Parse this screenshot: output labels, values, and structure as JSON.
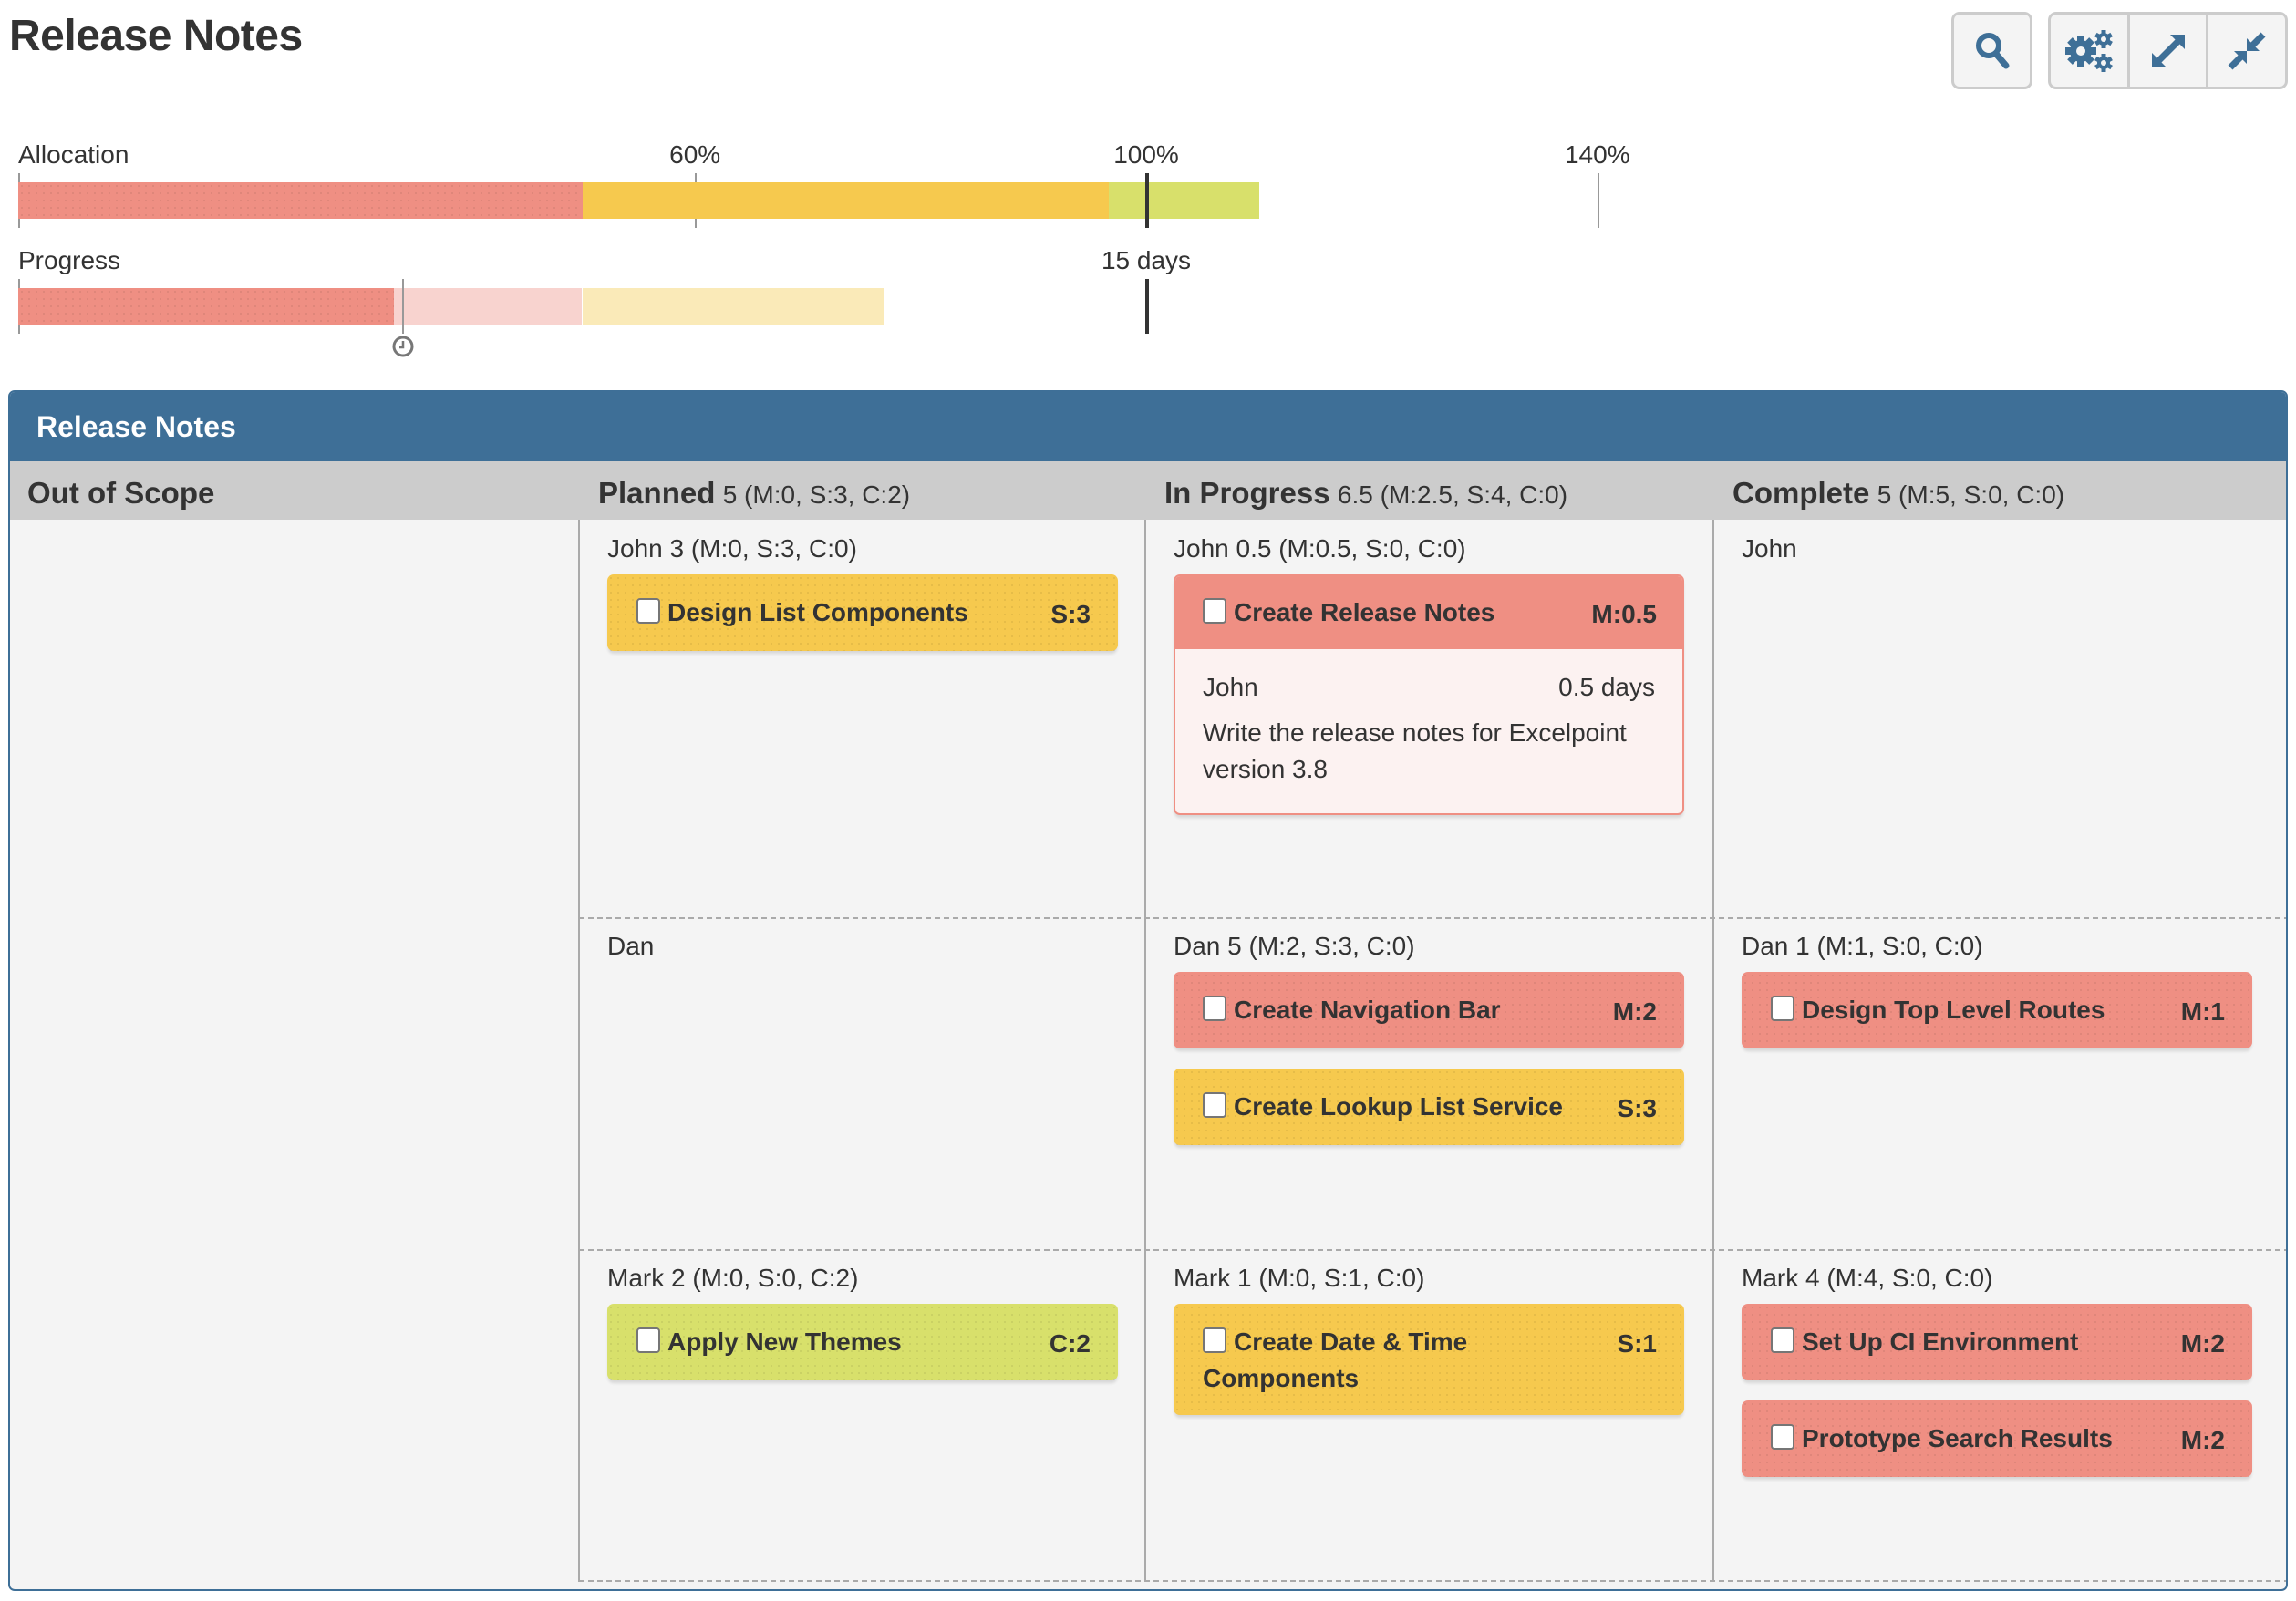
{
  "page": {
    "title": "Release Notes"
  },
  "toolbar": {
    "buttons": [
      {
        "name": "search",
        "icon": "search-icon"
      },
      {
        "name": "settings",
        "icon": "gears-icon"
      },
      {
        "name": "expand",
        "icon": "expand-icon"
      },
      {
        "name": "collapse",
        "icon": "compress-icon"
      }
    ]
  },
  "colors": {
    "must": "#ef8f83",
    "must_light": "#f8d3cf",
    "should": "#f6c94e",
    "should_light": "#faeab8",
    "could": "#d8e06b",
    "panel_header": "#3e6f97",
    "icon": "#3e6f97"
  },
  "meters": {
    "allocation": {
      "label": "Allocation",
      "ticks": [
        {
          "label": "60%",
          "value": 60
        },
        {
          "label": "100%",
          "value": 100,
          "major": true
        },
        {
          "label": "140%",
          "value": 140
        }
      ],
      "segments": [
        {
          "category": "must",
          "from": 0,
          "to": 50
        },
        {
          "category": "should",
          "from": 50,
          "to": 96.7
        },
        {
          "category": "could",
          "from": 96.7,
          "to": 110
        }
      ]
    },
    "progress": {
      "label": "Progress",
      "capacity_label": "15 days",
      "capacity_value": 100,
      "today_marker": 34,
      "segments": [
        {
          "category": "must",
          "from": 0,
          "to": 33.3
        },
        {
          "category": "must_light",
          "from": 33.3,
          "to": 50
        },
        {
          "category": "should_light",
          "from": 50,
          "to": 76.7
        }
      ]
    }
  },
  "board": {
    "title": "Release Notes",
    "columns": [
      {
        "name": "Out of Scope",
        "meta": ""
      },
      {
        "name": "Planned",
        "meta": "5 (M:0, S:3, C:2)"
      },
      {
        "name": "In Progress",
        "meta": "6.5 (M:2.5, S:4, C:0)"
      },
      {
        "name": "Complete",
        "meta": "5 (M:5, S:0, C:0)"
      }
    ],
    "rows": [
      {
        "person": "John",
        "cells": [
          null,
          {
            "label": "John 3 (M:0, S:3, C:0)",
            "cards": [
              {
                "title": "Design List Components",
                "size": "S:3",
                "category": "should"
              }
            ]
          },
          {
            "label": "John 0.5 (M:0.5, S:0, C:0)",
            "cards": [
              {
                "title": "Create Release Notes",
                "size": "M:0.5",
                "category": "must",
                "expanded": true,
                "assignee": "John",
                "estimate": "0.5 days",
                "description": "Write the release notes for Excelpoint version 3.8"
              }
            ]
          },
          {
            "label": "John",
            "cards": []
          }
        ]
      },
      {
        "person": "Dan",
        "cells": [
          null,
          {
            "label": "Dan",
            "cards": []
          },
          {
            "label": "Dan 5 (M:2, S:3, C:0)",
            "cards": [
              {
                "title": "Create Navigation Bar",
                "size": "M:2",
                "category": "must"
              },
              {
                "title": "Create Lookup List Service",
                "size": "S:3",
                "category": "should"
              }
            ]
          },
          {
            "label": "Dan 1 (M:1, S:0, C:0)",
            "cards": [
              {
                "title": "Design Top Level Routes",
                "size": "M:1",
                "category": "must"
              }
            ]
          }
        ]
      },
      {
        "person": "Mark",
        "cells": [
          null,
          {
            "label": "Mark 2 (M:0, S:0, C:2)",
            "cards": [
              {
                "title": "Apply New Themes",
                "size": "C:2",
                "category": "could"
              }
            ]
          },
          {
            "label": "Mark 1 (M:0, S:1, C:0)",
            "cards": [
              {
                "title": "Create Date & Time Components",
                "size": "S:1",
                "category": "should"
              }
            ]
          },
          {
            "label": "Mark 4 (M:4, S:0, C:0)",
            "cards": [
              {
                "title": "Set Up CI Environment",
                "size": "M:2",
                "category": "must"
              },
              {
                "title": "Prototype Search Results",
                "size": "M:2",
                "category": "must"
              }
            ]
          }
        ]
      }
    ]
  }
}
